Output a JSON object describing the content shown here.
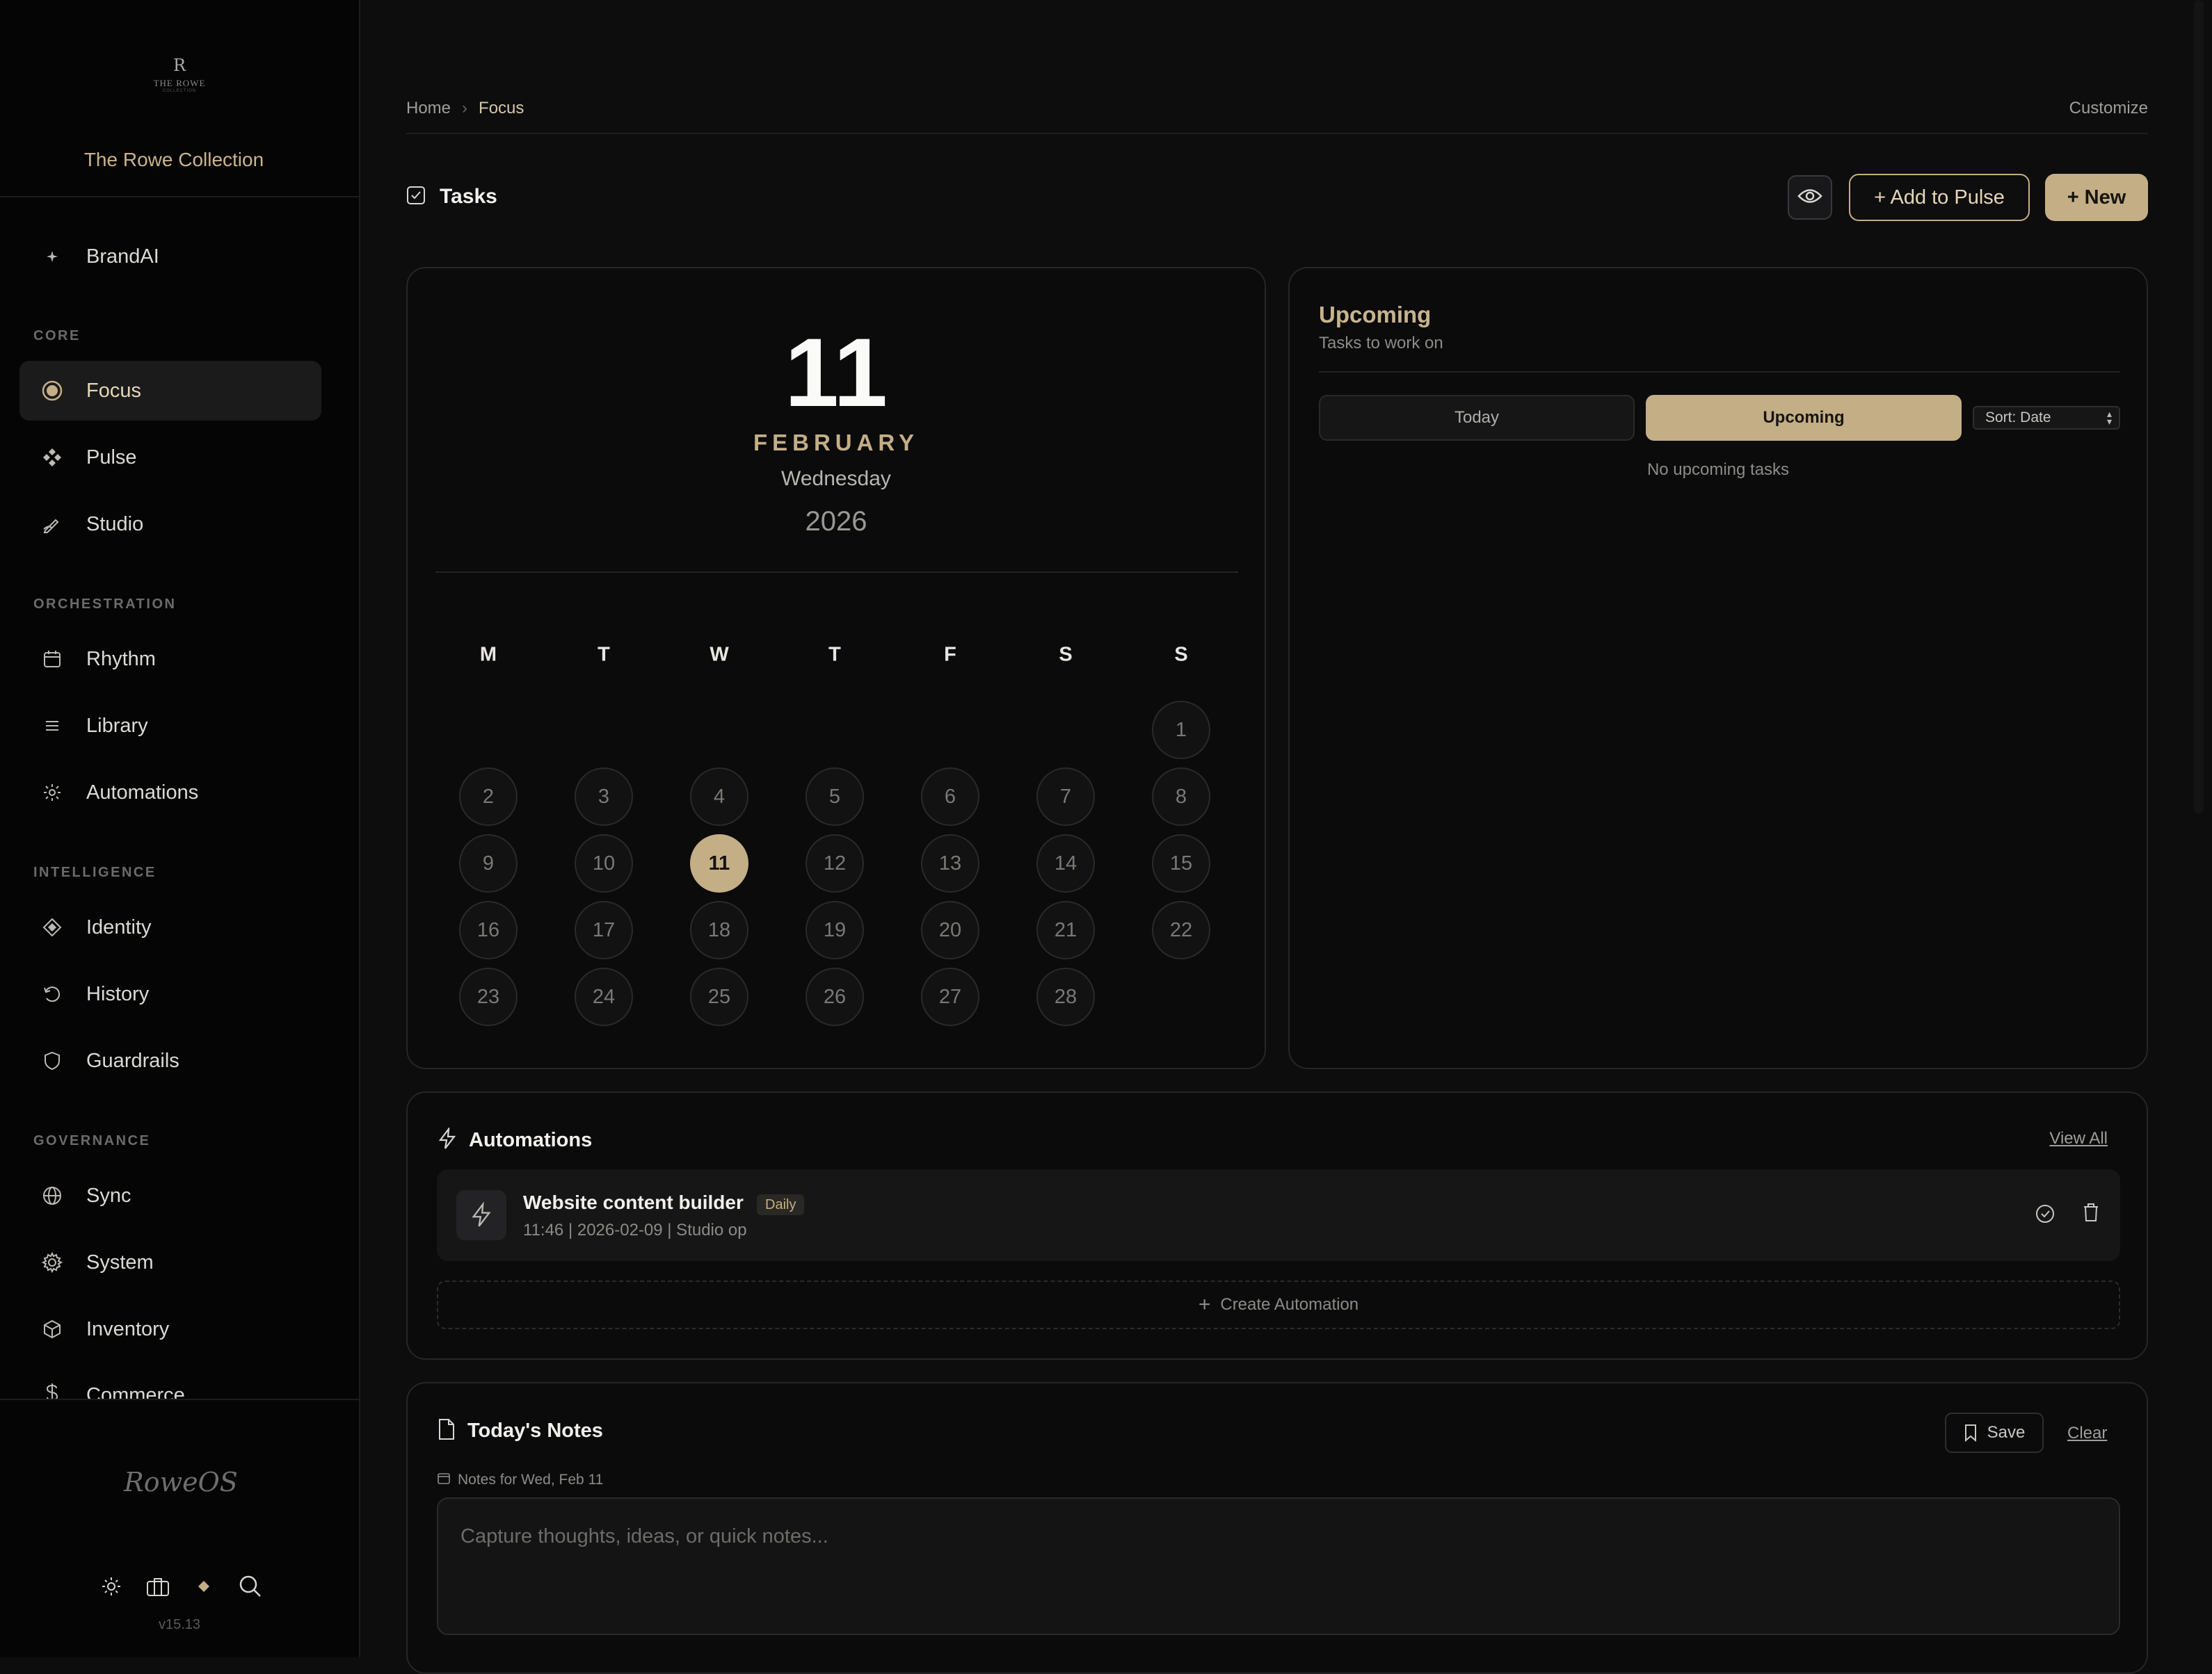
{
  "sidebar": {
    "logo": {
      "monogram": "R",
      "line1": "THE ROWE",
      "line2": "COLLECTION"
    },
    "brand_name": "The Rowe Collection",
    "top_item": {
      "label": "BrandAI",
      "icon": "sparkle-icon"
    },
    "sections": [
      {
        "label": "CORE",
        "items": [
          {
            "label": "Focus",
            "icon": "target-icon",
            "active": true
          },
          {
            "label": "Pulse",
            "icon": "diamonds-icon"
          },
          {
            "label": "Studio",
            "icon": "pen-icon"
          }
        ]
      },
      {
        "label": "ORCHESTRATION",
        "items": [
          {
            "label": "Rhythm",
            "icon": "calendar-icon"
          },
          {
            "label": "Library",
            "icon": "list-icon"
          },
          {
            "label": "Automations",
            "icon": "spark-gear-icon"
          }
        ]
      },
      {
        "label": "INTELLIGENCE",
        "items": [
          {
            "label": "Identity",
            "icon": "diamond-icon"
          },
          {
            "label": "History",
            "icon": "history-icon"
          },
          {
            "label": "Guardrails",
            "icon": "shield-icon"
          }
        ]
      },
      {
        "label": "GOVERNANCE",
        "items": [
          {
            "label": "Sync",
            "icon": "globe-icon"
          },
          {
            "label": "System",
            "icon": "gear-icon"
          },
          {
            "label": "Inventory",
            "icon": "box-icon"
          },
          {
            "label": "Commerce",
            "icon": "dollar-icon"
          }
        ]
      }
    ],
    "signature": "RoweOS",
    "version": "v15.13"
  },
  "breadcrumb": {
    "home": "Home",
    "separator": "›",
    "current": "Focus"
  },
  "customize": "Customize",
  "tasks": {
    "title": "Tasks",
    "add_to_pulse": "+ Add to Pulse",
    "new": "+ New"
  },
  "calendar": {
    "day": "11",
    "month": "FEBRUARY",
    "weekday": "Wednesday",
    "year": "2026",
    "dow": [
      "M",
      "T",
      "W",
      "T",
      "F",
      "S",
      "S"
    ],
    "first_col": 6,
    "days_in_month": 28,
    "today": 11
  },
  "upcoming": {
    "title": "Upcoming",
    "subtitle": "Tasks to work on",
    "tab_today": "Today",
    "tab_upcoming": "Upcoming",
    "sort": "Sort: Date",
    "empty": "No upcoming tasks"
  },
  "automations": {
    "title": "Automations",
    "view_all": "View All",
    "items": [
      {
        "name": "Website content builder",
        "badge": "Daily",
        "meta": "11:46 | 2026-02-09 | Studio op"
      }
    ],
    "create": "Create Automation"
  },
  "notes": {
    "title": "Today's Notes",
    "save": "Save",
    "clear": "Clear",
    "for_label": "Notes for Wed, Feb 11",
    "placeholder": "Capture thoughts, ideas, or quick notes..."
  },
  "colors": {
    "accent": "#c4ae86",
    "background": "#0d0d0e",
    "sidebar": "#050505"
  }
}
